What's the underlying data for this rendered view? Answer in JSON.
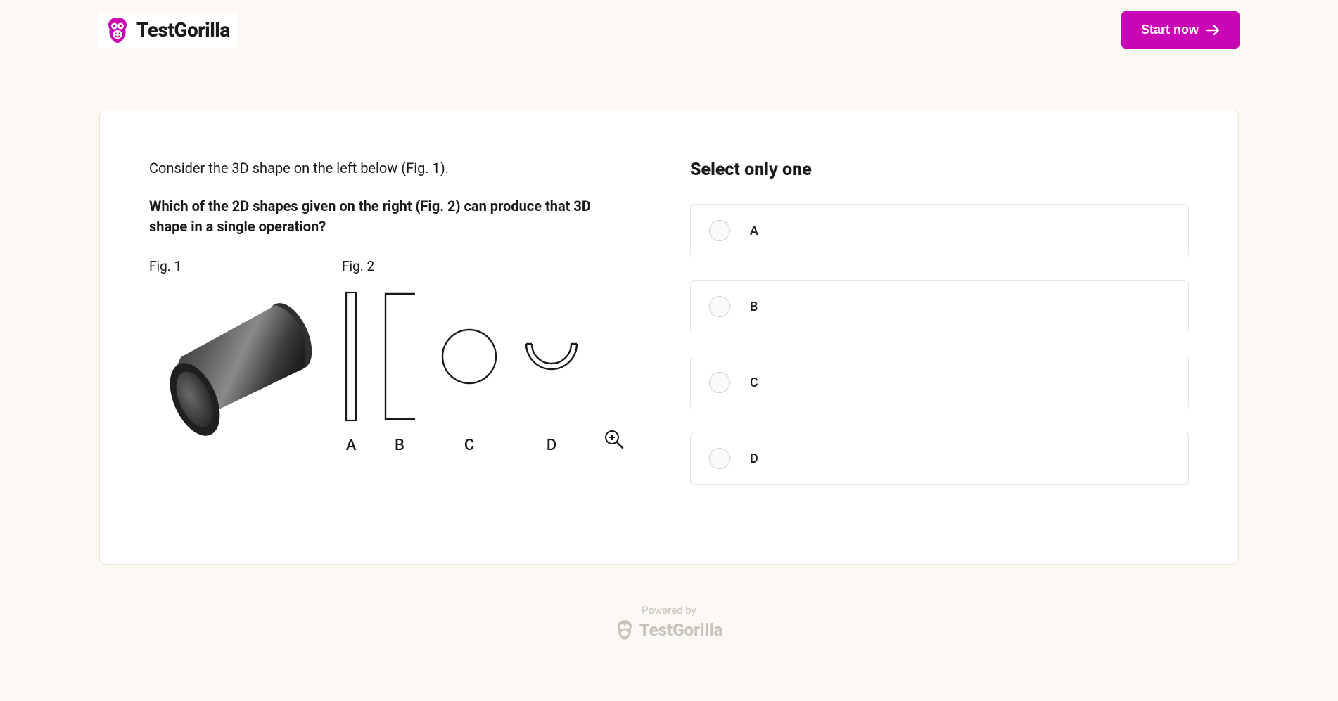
{
  "header": {
    "logo_text": "TestGorilla",
    "cta_label": "Start now"
  },
  "question": {
    "intro": "Consider the 3D shape on the left below (Fig. 1).",
    "main": "Which of the 2D shapes given on the right (Fig. 2) can produce that 3D shape in a single operation?",
    "fig1_label": "Fig. 1",
    "fig2_label": "Fig. 2",
    "shapes": {
      "a": "A",
      "b": "B",
      "c": "C",
      "d": "D"
    }
  },
  "answers": {
    "heading": "Select only one",
    "options": {
      "a": "A",
      "b": "B",
      "c": "C",
      "d": "D"
    }
  },
  "footer": {
    "powered": "Powered by",
    "logo_text": "TestGorilla"
  }
}
